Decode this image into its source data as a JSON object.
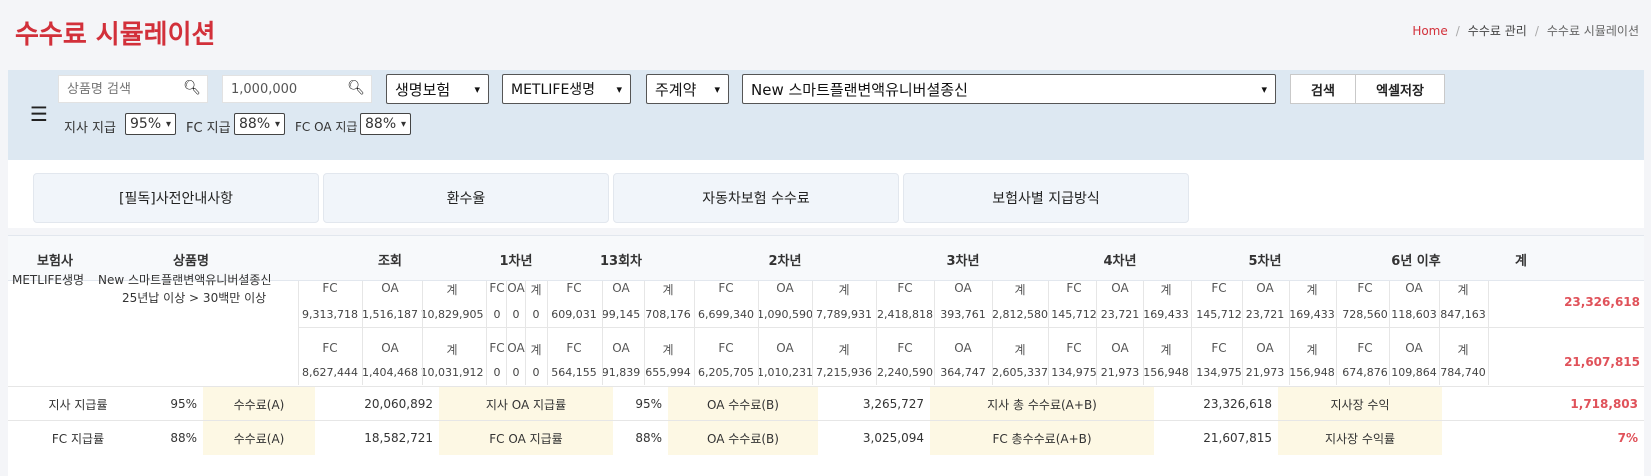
{
  "page": {
    "title": "수수료 시뮬레이션"
  },
  "breadcrumb": {
    "home": "Home",
    "parent": "수수료 관리",
    "current": "수수료 시뮬레이션"
  },
  "filters": {
    "product_search_placeholder": "상품명 검색",
    "amount_value": "1,000,000",
    "insurance_type": "생명보험",
    "company": "METLIFE생명",
    "contract_type": "주계약",
    "product": "New 스마트플랜변액유니버셜종신",
    "search_button": "검색",
    "excel_button": "엑셀저장",
    "branch_pay_label": "지사 지급",
    "branch_pay_value": "95%",
    "fc_pay_label": "FC 지급",
    "fc_pay_value": "88%",
    "fc_oa_pay_label": "FC OA 지급",
    "fc_oa_pay_value": "88%"
  },
  "tabs": [
    "[필독]사전안내사항",
    "환수율",
    "자동차보험 수수료",
    "보험사별 지급방식"
  ],
  "table": {
    "headers": [
      "보험사",
      "상품명",
      "조회",
      "1차년",
      "13회차",
      "2차년",
      "3차년",
      "4차년",
      "5차년",
      "6년 이후",
      "계"
    ],
    "company": "METLIFE생명",
    "product_line1": "New 스마트플랜변액유니버셜종신",
    "product_line2": "25년납 이상 > 30백만 이상",
    "sub_labels": [
      "FC",
      "OA",
      "계"
    ],
    "rows": [
      {
        "values": [
          "9,313,718",
          "1,516,187",
          "10,829,905",
          "0",
          "0",
          "0",
          "609,031",
          "99,145",
          "708,176",
          "6,699,340",
          "1,090,590",
          "7,789,931",
          "2,418,818",
          "393,761",
          "2,812,580",
          "145,712",
          "23,721",
          "169,433",
          "145,712",
          "23,721",
          "169,433",
          "728,560",
          "118,603",
          "847,163"
        ],
        "total": "23,326,618"
      },
      {
        "values": [
          "8,627,444",
          "1,404,468",
          "10,031,912",
          "0",
          "0",
          "0",
          "564,155",
          "91,839",
          "655,994",
          "6,205,705",
          "1,010,231",
          "7,215,936",
          "2,240,590",
          "364,747",
          "2,605,337",
          "134,975",
          "21,973",
          "156,948",
          "134,975",
          "21,973",
          "156,948",
          "674,876",
          "109,864",
          "784,740"
        ],
        "total": "21,607,815"
      }
    ]
  },
  "summary": [
    [
      "지사 지급률",
      "95%",
      "수수료(A)",
      "20,060,892",
      "지사 OA 지급률",
      "95%",
      "OA 수수료(B)",
      "3,265,727",
      "지사 총 수수료(A+B)",
      "23,326,618",
      "지사장 수익",
      "1,718,803"
    ],
    [
      "FC 지급률",
      "88%",
      "수수료(A)",
      "18,582,721",
      "FC OA 지급률",
      "88%",
      "OA 수수료(B)",
      "3,025,094",
      "FC 총수수료(A+B)",
      "21,607,815",
      "지사장 수익률",
      "7%"
    ]
  ]
}
